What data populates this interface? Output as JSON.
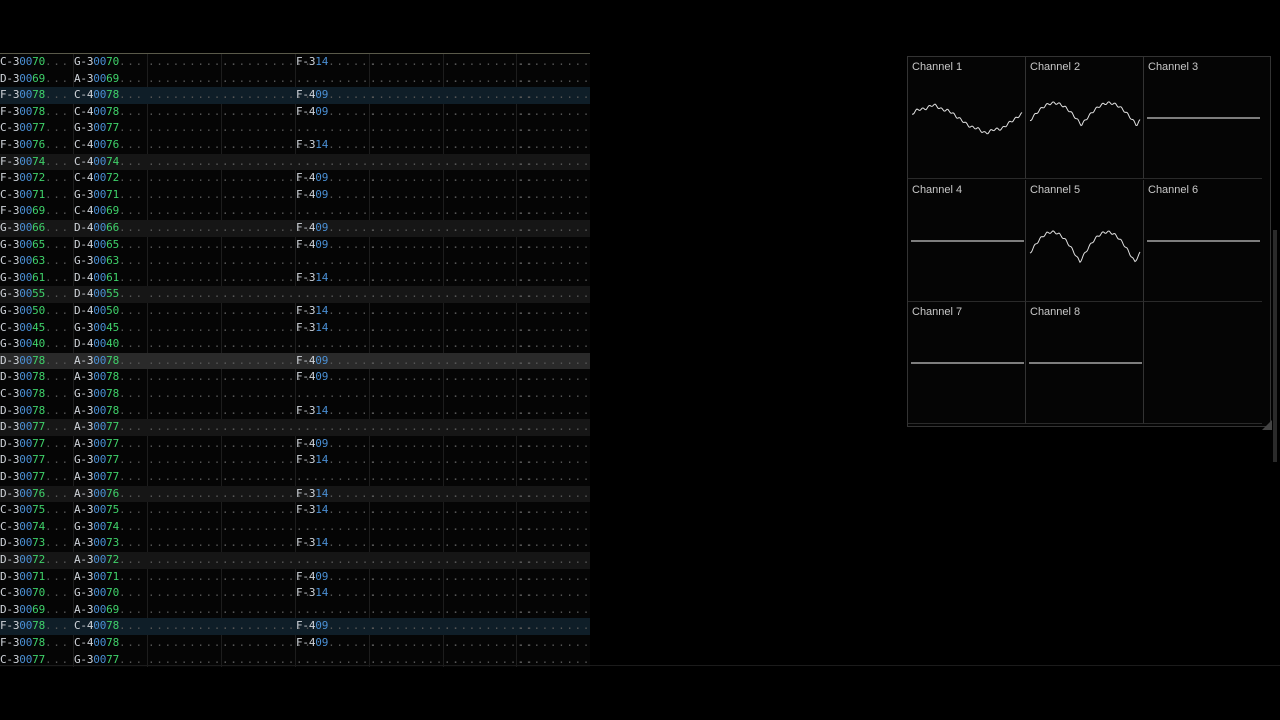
{
  "pattern": {
    "rows": [
      {
        "c1": "C-3",
        "i1": "00",
        "v1": "70",
        "c2": "G-3",
        "i2": "00",
        "v2": "70",
        "eff": "F-3",
        "ev": "14",
        "style": ""
      },
      {
        "c1": "D-3",
        "i1": "00",
        "v1": "69",
        "c2": "A-3",
        "i2": "00",
        "v2": "69",
        "eff": "",
        "ev": "",
        "style": ""
      },
      {
        "c1": "F-3",
        "i1": "00",
        "v1": "78",
        "c2": "C-4",
        "i2": "00",
        "v2": "78",
        "eff": "F-4",
        "ev": "09",
        "style": "hl"
      },
      {
        "c1": "F-3",
        "i1": "00",
        "v1": "78",
        "c2": "C-4",
        "i2": "00",
        "v2": "78",
        "eff": "F-4",
        "ev": "09",
        "style": ""
      },
      {
        "c1": "C-3",
        "i1": "00",
        "v1": "77",
        "c2": "G-3",
        "i2": "00",
        "v2": "77",
        "eff": "",
        "ev": "",
        "style": ""
      },
      {
        "c1": "F-3",
        "i1": "00",
        "v1": "76",
        "c2": "C-4",
        "i2": "00",
        "v2": "76",
        "eff": "F-3",
        "ev": "14",
        "style": ""
      },
      {
        "c1": "F-3",
        "i1": "00",
        "v1": "74",
        "c2": "C-4",
        "i2": "00",
        "v2": "74",
        "eff": "",
        "ev": "",
        "style": "beat"
      },
      {
        "c1": "F-3",
        "i1": "00",
        "v1": "72",
        "c2": "C-4",
        "i2": "00",
        "v2": "72",
        "eff": "F-4",
        "ev": "09",
        "style": ""
      },
      {
        "c1": "C-3",
        "i1": "00",
        "v1": "71",
        "c2": "G-3",
        "i2": "00",
        "v2": "71",
        "eff": "F-4",
        "ev": "09",
        "style": ""
      },
      {
        "c1": "F-3",
        "i1": "00",
        "v1": "69",
        "c2": "C-4",
        "i2": "00",
        "v2": "69",
        "eff": "",
        "ev": "",
        "style": ""
      },
      {
        "c1": "G-3",
        "i1": "00",
        "v1": "66",
        "c2": "D-4",
        "i2": "00",
        "v2": "66",
        "eff": "F-4",
        "ev": "09",
        "style": "beat"
      },
      {
        "c1": "G-3",
        "i1": "00",
        "v1": "65",
        "c2": "D-4",
        "i2": "00",
        "v2": "65",
        "eff": "F-4",
        "ev": "09",
        "style": ""
      },
      {
        "c1": "C-3",
        "i1": "00",
        "v1": "63",
        "c2": "G-3",
        "i2": "00",
        "v2": "63",
        "eff": "",
        "ev": "",
        "style": ""
      },
      {
        "c1": "G-3",
        "i1": "00",
        "v1": "61",
        "c2": "D-4",
        "i2": "00",
        "v2": "61",
        "eff": "F-3",
        "ev": "14",
        "style": ""
      },
      {
        "c1": "G-3",
        "i1": "00",
        "v1": "55",
        "c2": "D-4",
        "i2": "00",
        "v2": "55",
        "eff": "",
        "ev": "",
        "style": "beat"
      },
      {
        "c1": "G-3",
        "i1": "00",
        "v1": "50",
        "c2": "D-4",
        "i2": "00",
        "v2": "50",
        "eff": "F-3",
        "ev": "14",
        "style": ""
      },
      {
        "c1": "C-3",
        "i1": "00",
        "v1": "45",
        "c2": "G-3",
        "i2": "00",
        "v2": "45",
        "eff": "F-3",
        "ev": "14",
        "style": ""
      },
      {
        "c1": "G-3",
        "i1": "00",
        "v1": "40",
        "c2": "D-4",
        "i2": "00",
        "v2": "40",
        "eff": "",
        "ev": "",
        "style": ""
      },
      {
        "c1": "D-3",
        "i1": "00",
        "v1": "78",
        "c2": "A-3",
        "i2": "00",
        "v2": "78",
        "eff": "F-4",
        "ev": "09",
        "style": "cursor"
      },
      {
        "c1": "D-3",
        "i1": "00",
        "v1": "78",
        "c2": "A-3",
        "i2": "00",
        "v2": "78",
        "eff": "F-4",
        "ev": "09",
        "style": ""
      },
      {
        "c1": "C-3",
        "i1": "00",
        "v1": "78",
        "c2": "G-3",
        "i2": "00",
        "v2": "78",
        "eff": "",
        "ev": "",
        "style": ""
      },
      {
        "c1": "D-3",
        "i1": "00",
        "v1": "78",
        "c2": "A-3",
        "i2": "00",
        "v2": "78",
        "eff": "F-3",
        "ev": "14",
        "style": ""
      },
      {
        "c1": "D-3",
        "i1": "00",
        "v1": "77",
        "c2": "A-3",
        "i2": "00",
        "v2": "77",
        "eff": "",
        "ev": "",
        "style": "beat"
      },
      {
        "c1": "D-3",
        "i1": "00",
        "v1": "77",
        "c2": "A-3",
        "i2": "00",
        "v2": "77",
        "eff": "F-4",
        "ev": "09",
        "style": ""
      },
      {
        "c1": "D-3",
        "i1": "00",
        "v1": "77",
        "c2": "G-3",
        "i2": "00",
        "v2": "77",
        "eff": "F-3",
        "ev": "14",
        "style": ""
      },
      {
        "c1": "D-3",
        "i1": "00",
        "v1": "77",
        "c2": "A-3",
        "i2": "00",
        "v2": "77",
        "eff": "",
        "ev": "",
        "style": ""
      },
      {
        "c1": "D-3",
        "i1": "00",
        "v1": "76",
        "c2": "A-3",
        "i2": "00",
        "v2": "76",
        "eff": "F-3",
        "ev": "14",
        "style": "beat"
      },
      {
        "c1": "C-3",
        "i1": "00",
        "v1": "75",
        "c2": "A-3",
        "i2": "00",
        "v2": "75",
        "eff": "F-3",
        "ev": "14",
        "style": ""
      },
      {
        "c1": "C-3",
        "i1": "00",
        "v1": "74",
        "c2": "G-3",
        "i2": "00",
        "v2": "74",
        "eff": "",
        "ev": "",
        "style": ""
      },
      {
        "c1": "D-3",
        "i1": "00",
        "v1": "73",
        "c2": "A-3",
        "i2": "00",
        "v2": "73",
        "eff": "F-3",
        "ev": "14",
        "style": ""
      },
      {
        "c1": "D-3",
        "i1": "00",
        "v1": "72",
        "c2": "A-3",
        "i2": "00",
        "v2": "72",
        "eff": "",
        "ev": "",
        "style": "beat"
      },
      {
        "c1": "D-3",
        "i1": "00",
        "v1": "71",
        "c2": "A-3",
        "i2": "00",
        "v2": "71",
        "eff": "F-4",
        "ev": "09",
        "style": ""
      },
      {
        "c1": "C-3",
        "i1": "00",
        "v1": "70",
        "c2": "G-3",
        "i2": "00",
        "v2": "70",
        "eff": "F-3",
        "ev": "14",
        "style": ""
      },
      {
        "c1": "D-3",
        "i1": "00",
        "v1": "69",
        "c2": "A-3",
        "i2": "00",
        "v2": "69",
        "eff": "",
        "ev": "",
        "style": ""
      },
      {
        "c1": "F-3",
        "i1": "00",
        "v1": "78",
        "c2": "C-4",
        "i2": "00",
        "v2": "78",
        "eff": "F-4",
        "ev": "09",
        "style": "hl"
      },
      {
        "c1": "F-3",
        "i1": "00",
        "v1": "78",
        "c2": "C-4",
        "i2": "00",
        "v2": "78",
        "eff": "F-4",
        "ev": "09",
        "style": ""
      },
      {
        "c1": "C-3",
        "i1": "00",
        "v1": "77",
        "c2": "G-3",
        "i2": "00",
        "v2": "77",
        "eff": "",
        "ev": "",
        "style": ""
      }
    ]
  },
  "oscilloscope": {
    "channels": [
      {
        "label": "Channel 1",
        "wave": "active"
      },
      {
        "label": "Channel 2",
        "wave": "active"
      },
      {
        "label": "Channel 3",
        "wave": "flat"
      },
      {
        "label": "Channel 4",
        "wave": "flat"
      },
      {
        "label": "Channel 5",
        "wave": "active"
      },
      {
        "label": "Channel 6",
        "wave": "flat"
      },
      {
        "label": "Channel 7",
        "wave": "flat"
      },
      {
        "label": "Channel 8",
        "wave": "flat"
      },
      {
        "label": "",
        "wave": "none"
      }
    ]
  },
  "colors": {
    "note": "#cfd3d9",
    "instrument": "#4a8fd4",
    "volume": "#3fd16a",
    "effect_value": "#4a8fd4"
  }
}
